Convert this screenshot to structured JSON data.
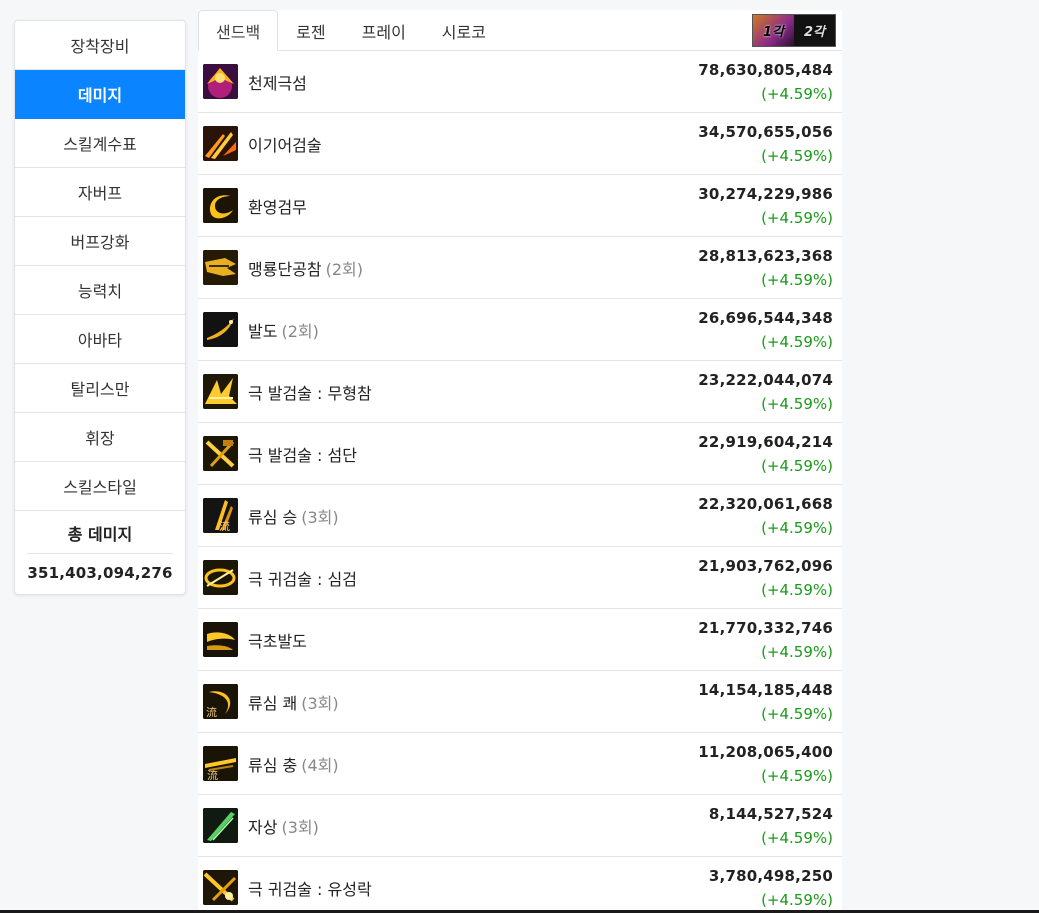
{
  "sidebar": {
    "items": [
      {
        "label": "장착장비",
        "active": false
      },
      {
        "label": "데미지",
        "active": true
      },
      {
        "label": "스킬계수표",
        "active": false
      },
      {
        "label": "자버프",
        "active": false
      },
      {
        "label": "버프강화",
        "active": false
      },
      {
        "label": "능력치",
        "active": false
      },
      {
        "label": "아바타",
        "active": false
      },
      {
        "label": "탈리스만",
        "active": false
      },
      {
        "label": "휘장",
        "active": false
      },
      {
        "label": "스킬스타일",
        "active": false
      }
    ],
    "total_title": "총 데미지",
    "total_value": "351,403,094,276"
  },
  "tabs": [
    {
      "label": "샌드백",
      "active": true
    },
    {
      "label": "로젠",
      "active": false
    },
    {
      "label": "프레이",
      "active": false
    },
    {
      "label": "시로코",
      "active": false
    }
  ],
  "awaken_toggle": {
    "first": "1각",
    "second": "2각"
  },
  "skills": [
    {
      "name": "천제극섬",
      "count": "",
      "damage": "78,630,805,484",
      "pct": "(+4.59%)",
      "icon": "purple-burst-icon"
    },
    {
      "name": "이기어검술",
      "count": "",
      "damage": "34,570,655,056",
      "pct": "(+4.59%)",
      "icon": "flying-swords-icon"
    },
    {
      "name": "환영검무",
      "count": "",
      "damage": "30,274,229,986",
      "pct": "(+4.59%)",
      "icon": "phantom-slash-icon"
    },
    {
      "name": "맹룡단공참",
      "count": "(2회)",
      "damage": "28,813,623,368",
      "pct": "(+4.59%)",
      "icon": "dragon-slash-icon"
    },
    {
      "name": "발도",
      "count": "(2회)",
      "damage": "26,696,544,348",
      "pct": "(+4.59%)",
      "icon": "draw-slash-icon"
    },
    {
      "name": "극 발검술 : 무형참",
      "count": "",
      "damage": "23,222,044,074",
      "pct": "(+4.59%)",
      "icon": "formless-slash-icon"
    },
    {
      "name": "극 발검술 : 섬단",
      "count": "",
      "damage": "22,919,604,214",
      "pct": "(+4.59%)",
      "icon": "flash-cut-icon"
    },
    {
      "name": "류심 승",
      "count": "(3회)",
      "damage": "22,320,061,668",
      "pct": "(+4.59%)",
      "icon": "ryusim-rise-icon"
    },
    {
      "name": "극 귀검술 : 심검",
      "count": "",
      "damage": "21,903,762,096",
      "pct": "(+4.59%)",
      "icon": "mind-sword-icon"
    },
    {
      "name": "극초발도",
      "count": "",
      "damage": "21,770,332,746",
      "pct": "(+4.59%)",
      "icon": "ultimate-draw-icon"
    },
    {
      "name": "류심 쾌",
      "count": "(3회)",
      "damage": "14,154,185,448",
      "pct": "(+4.59%)",
      "icon": "ryusim-swift-icon"
    },
    {
      "name": "류심 충",
      "count": "(4회)",
      "damage": "11,208,065,400",
      "pct": "(+4.59%)",
      "icon": "ryusim-thrust-icon"
    },
    {
      "name": "자상",
      "count": "(3회)",
      "damage": "8,144,527,524",
      "pct": "(+4.59%)",
      "icon": "green-blade-icon"
    },
    {
      "name": "극 귀검술 : 유성락",
      "count": "",
      "damage": "3,780,498,250",
      "pct": "(+4.59%)",
      "icon": "meteor-fall-icon"
    }
  ]
}
